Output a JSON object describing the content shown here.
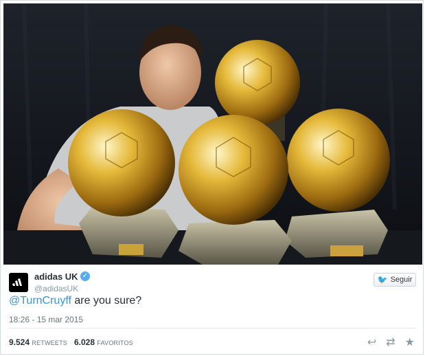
{
  "account": {
    "name": "adidas UK",
    "handle": "@adidasUK",
    "follow_label": "Seguir"
  },
  "tweet": {
    "mention": "@TurnCruyff",
    "text": " are you sure?",
    "timestamp": "18:26 - 15 mar 2015"
  },
  "stats": {
    "retweets_count": "9.524",
    "retweets_label": "RETWEETS",
    "favorites_count": "6.028",
    "favorites_label": "FAVORITOS"
  },
  "icons": {
    "verified": "verified-badge-icon",
    "reply": "reply-icon",
    "retweet": "retweet-icon",
    "favorite": "star-icon",
    "follow": "twitter-bird-icon"
  },
  "colors": {
    "accent": "#55acee",
    "link": "#3b94d9",
    "text": "#292f33",
    "muted": "#8899a6"
  }
}
